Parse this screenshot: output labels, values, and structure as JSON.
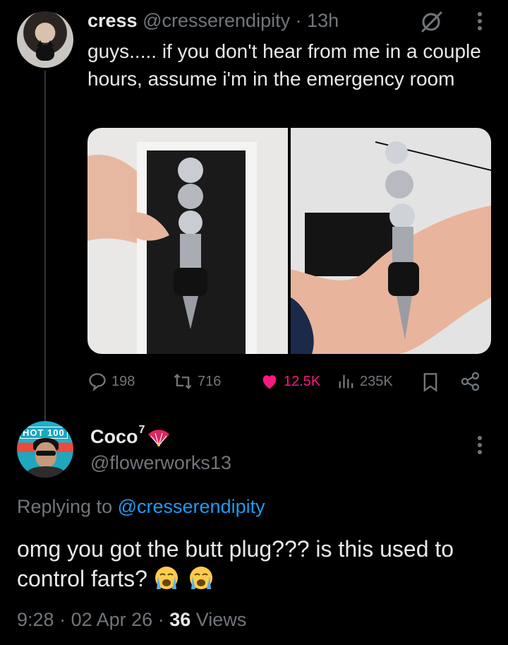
{
  "tweet": {
    "display_name": "cress",
    "handle": "@cresserendipity",
    "separator": "·",
    "time": "13h",
    "text": "guys..... if you don't hear from me in a couple hours, assume i'm in the emergency room",
    "stats": {
      "replies": "198",
      "reposts": "716",
      "likes": "12.5K",
      "views": "235K"
    },
    "colors": {
      "like": "#f91880",
      "muted": "#71767b",
      "link": "#1d9bf0"
    }
  },
  "reply": {
    "display_name": "Coco",
    "name_superscript": "7",
    "handle": "@flowerworks13",
    "avatar_text": "HOT 100",
    "replying_prefix": "Replying to",
    "replying_handle": "@cresserendipity",
    "text": "omg you got the butt plug??? is this used to control farts?",
    "time": "9:28",
    "separator": "·",
    "date": "02 Apr 26",
    "views_count": "36",
    "views_label": "Views"
  },
  "icons": [
    "grok-icon",
    "more-icon",
    "reply-icon",
    "repost-icon",
    "heart-icon",
    "views-icon",
    "bookmark-icon",
    "share-icon",
    "fan-icon",
    "crying-face-icon"
  ]
}
